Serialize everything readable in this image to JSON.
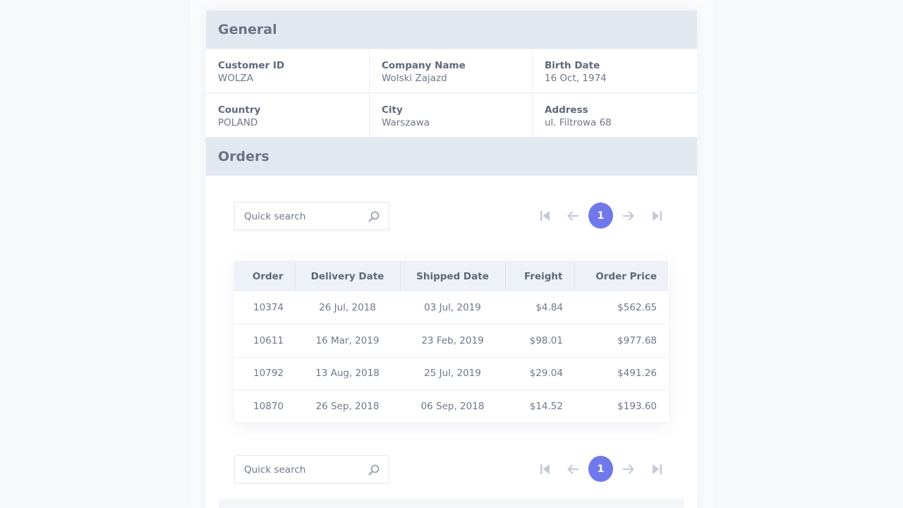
{
  "general": {
    "title": "General",
    "fields": [
      {
        "label": "Customer ID",
        "value": "WOLZA"
      },
      {
        "label": "Company Name",
        "value": "Wolski Zajazd"
      },
      {
        "label": "Birth Date",
        "value": "16 Oct, 1974"
      },
      {
        "label": "Country",
        "value": "POLAND"
      },
      {
        "label": "City",
        "value": "Warszawa"
      },
      {
        "label": "Address",
        "value": "ul. Filtrowa 68"
      }
    ]
  },
  "orders": {
    "title": "Orders",
    "search_placeholder": "Quick search",
    "current_page": "1",
    "columns": [
      "Order",
      "Delivery Date",
      "Shipped Date",
      "Freight",
      "Order Price"
    ],
    "rows": [
      [
        "10374",
        "26 Jul, 2018",
        "03 Jul, 2019",
        "$4.84",
        "$562.65"
      ],
      [
        "10611",
        "16 Mar, 2019",
        "23 Feb, 2019",
        "$98.01",
        "$977.68"
      ],
      [
        "10792",
        "13 Aug, 2018",
        "25 Jul, 2019",
        "$29.04",
        "$491.26"
      ],
      [
        "10870",
        "26 Sep, 2018",
        "06 Sep, 2018",
        "$14.52",
        "$193.60"
      ]
    ]
  },
  "colors": {
    "accent": "#7179ea",
    "header_bg": "#e2e8f0",
    "pager_icon": "#c5cbd6"
  },
  "icons": {
    "search": "search-icon",
    "first": "first-page-icon",
    "prev": "prev-page-icon",
    "next": "next-page-icon",
    "last": "last-page-icon"
  }
}
